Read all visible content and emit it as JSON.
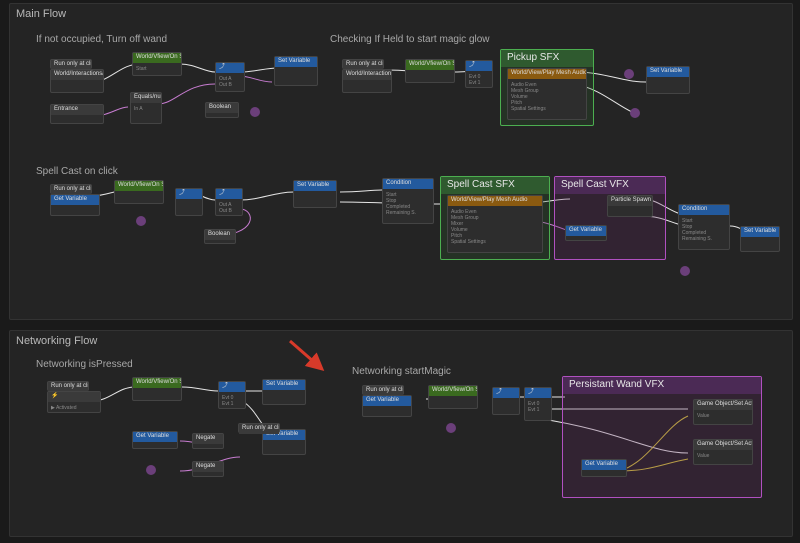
{
  "section_main": {
    "title": "Main Flow"
  },
  "section_net": {
    "title": "Networking Flow"
  },
  "blocks": {
    "turn_off": "If not occupied, Turn off wand",
    "checking": "Checking If Held to start magic glow",
    "spell_click": "Spell Cast on click",
    "net_pressed": "Networking isPressed",
    "net_start": "Networking startMagic"
  },
  "groups": {
    "pickup_sfx": "Pickup SFX",
    "spell_sfx": "Spell Cast SFX",
    "spell_vfx": "Spell Cast VFX",
    "persist_vfx": "Persistant Wand VFX"
  },
  "nodeT": {
    "runon": "Run only at client s",
    "getEquipped": "World/Interactions/Get Equipped W",
    "onStateChange": "World/Vfiew/On State Change",
    "equals": "Equals/number",
    "branch": "Branch",
    "boolean": "Boolean",
    "setVar": "Set Variable",
    "getVar": "Get Variable",
    "condition": "Condition",
    "playMesh": "World/View/Play Mesh Audio",
    "negate": "Negate",
    "particle": "Particle Spawn",
    "setActive": "Game Object/Set Active",
    "entrance": "Entrance"
  },
  "pinT": {
    "inA": "In A",
    "outA": "Out A",
    "outB": "Out B",
    "start": "Start",
    "stop": "Stop",
    "completed": "Completed",
    "remaining": "Remaining S.",
    "audioEven": "Audio Even",
    "meshGroup": "Mesh Group",
    "mixer": "Mixer",
    "volume": "Volume",
    "pitch": "Pitch",
    "spatial": "Spatial Settings",
    "value": "Value",
    "activated": "▶ Activated",
    "evt0": "Evt 0",
    "evt1": "Evt 1"
  },
  "colors": {
    "arrow": "#d83a2a"
  }
}
